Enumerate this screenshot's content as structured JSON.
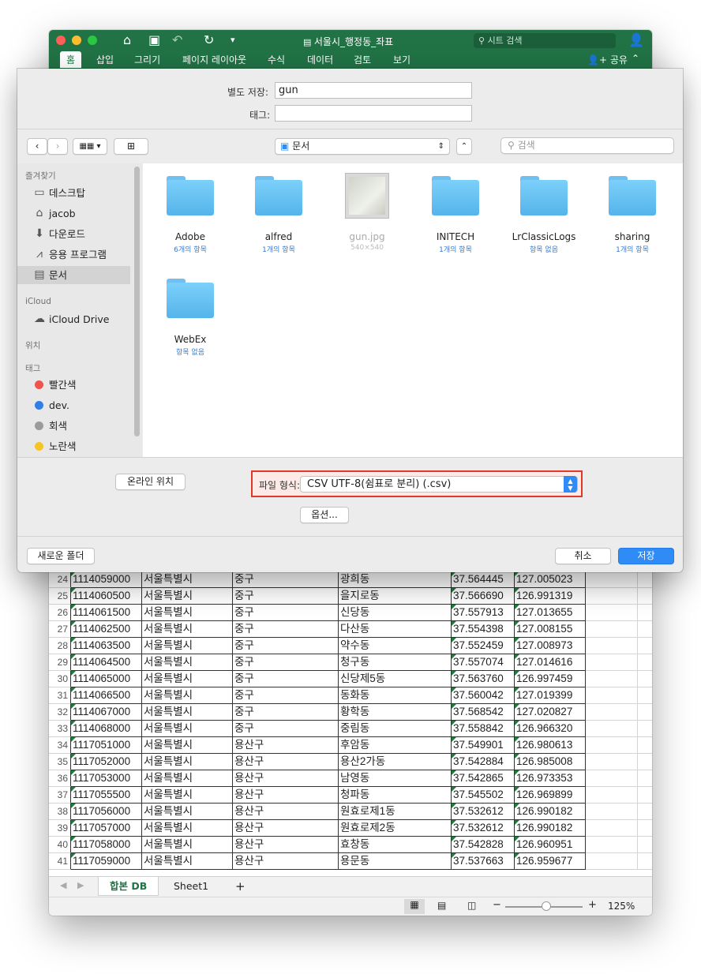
{
  "excel": {
    "doc_title": "서울시_행정동_좌표",
    "search_placeholder": "시트 검색",
    "share_label": "공유",
    "ribbon_tabs": [
      "홈",
      "삽입",
      "그리기",
      "페이지 레이아웃",
      "수식",
      "데이터",
      "검토",
      "보기"
    ],
    "rows": [
      {
        "n": "24",
        "code": "1114059000",
        "city": "서울특별시",
        "gu": "중구",
        "dong": "광희동",
        "lat": "37.564445",
        "lon": "127.005023"
      },
      {
        "n": "25",
        "code": "1114060500",
        "city": "서울특별시",
        "gu": "중구",
        "dong": "을지로동",
        "lat": "37.566690",
        "lon": "126.991319"
      },
      {
        "n": "26",
        "code": "1114061500",
        "city": "서울특별시",
        "gu": "중구",
        "dong": "신당동",
        "lat": "37.557913",
        "lon": "127.013655"
      },
      {
        "n": "27",
        "code": "1114062500",
        "city": "서울특별시",
        "gu": "중구",
        "dong": "다산동",
        "lat": "37.554398",
        "lon": "127.008155"
      },
      {
        "n": "28",
        "code": "1114063500",
        "city": "서울특별시",
        "gu": "중구",
        "dong": "약수동",
        "lat": "37.552459",
        "lon": "127.008973"
      },
      {
        "n": "29",
        "code": "1114064500",
        "city": "서울특별시",
        "gu": "중구",
        "dong": "청구동",
        "lat": "37.557074",
        "lon": "127.014616"
      },
      {
        "n": "30",
        "code": "1114065000",
        "city": "서울특별시",
        "gu": "중구",
        "dong": "신당제5동",
        "lat": "37.563760",
        "lon": "126.997459"
      },
      {
        "n": "31",
        "code": "1114066500",
        "city": "서울특별시",
        "gu": "중구",
        "dong": "동화동",
        "lat": "37.560042",
        "lon": "127.019399"
      },
      {
        "n": "32",
        "code": "1114067000",
        "city": "서울특별시",
        "gu": "중구",
        "dong": "황학동",
        "lat": "37.568542",
        "lon": "127.020827"
      },
      {
        "n": "33",
        "code": "1114068000",
        "city": "서울특별시",
        "gu": "중구",
        "dong": "중림동",
        "lat": "37.558842",
        "lon": "126.966320"
      },
      {
        "n": "34",
        "code": "1117051000",
        "city": "서울특별시",
        "gu": "용산구",
        "dong": "후암동",
        "lat": "37.549901",
        "lon": "126.980613"
      },
      {
        "n": "35",
        "code": "1117052000",
        "city": "서울특별시",
        "gu": "용산구",
        "dong": "용산2가동",
        "lat": "37.542884",
        "lon": "126.985008"
      },
      {
        "n": "36",
        "code": "1117053000",
        "city": "서울특별시",
        "gu": "용산구",
        "dong": "남영동",
        "lat": "37.542865",
        "lon": "126.973353"
      },
      {
        "n": "37",
        "code": "1117055500",
        "city": "서울특별시",
        "gu": "용산구",
        "dong": "청파동",
        "lat": "37.545502",
        "lon": "126.969899"
      },
      {
        "n": "38",
        "code": "1117056000",
        "city": "서울특별시",
        "gu": "용산구",
        "dong": "원효로제1동",
        "lat": "37.532612",
        "lon": "126.990182"
      },
      {
        "n": "39",
        "code": "1117057000",
        "city": "서울특별시",
        "gu": "용산구",
        "dong": "원효로제2동",
        "lat": "37.532612",
        "lon": "126.990182"
      },
      {
        "n": "40",
        "code": "1117058000",
        "city": "서울특별시",
        "gu": "용산구",
        "dong": "효창동",
        "lat": "37.542828",
        "lon": "126.960951"
      },
      {
        "n": "41",
        "code": "1117059000",
        "city": "서울특별시",
        "gu": "용산구",
        "dong": "용문동",
        "lat": "37.537663",
        "lon": "126.959677"
      }
    ],
    "sheet_tabs": [
      "합본 DB",
      "Sheet1"
    ],
    "add_sheet": "+",
    "zoom": "125%"
  },
  "dialog": {
    "save_as_label": "별도 저장:",
    "save_as_value": "gun",
    "tags_label": "태그:",
    "tags_value": "",
    "location": "문서",
    "search_placeholder": "검색",
    "sidebar": {
      "favorites_header": "즐겨찾기",
      "favorites": [
        "데스크탑",
        "jacob",
        "다운로드",
        "응용 프로그램",
        "문서"
      ],
      "icloud_header": "iCloud",
      "icloud": [
        "iCloud Drive"
      ],
      "locations_header": "위치",
      "tags_header": "태그",
      "tags": [
        {
          "label": "빨간색",
          "color": "#f0524c"
        },
        {
          "label": "dev.",
          "color": "#2f7fe6"
        },
        {
          "label": "회색",
          "color": "#9b9b9b"
        },
        {
          "label": "노란색",
          "color": "#f5c528"
        }
      ]
    },
    "files": [
      {
        "name": "Adobe",
        "sub": "6개의 항목"
      },
      {
        "name": "alfred",
        "sub": "1개의 항목"
      },
      {
        "name": "gun.jpg",
        "sub": "540×540"
      },
      {
        "name": "INITECH",
        "sub": "1개의 항목"
      },
      {
        "name": "LrClassicLogs",
        "sub": "항목 없음"
      },
      {
        "name": "sharing",
        "sub": "1개의 항목"
      },
      {
        "name": "WebEx",
        "sub": "항목 없음"
      }
    ],
    "online_locations": "온라인 위치",
    "format_label": "파일 형식:",
    "format_value": "CSV UTF-8(쉼표로 분리) (.csv)",
    "options": "옵션...",
    "new_folder": "새로운 폴더",
    "cancel": "취소",
    "save": "저장",
    "accent_color": "#2f8bf5",
    "highlight_color": "#e0392b"
  }
}
